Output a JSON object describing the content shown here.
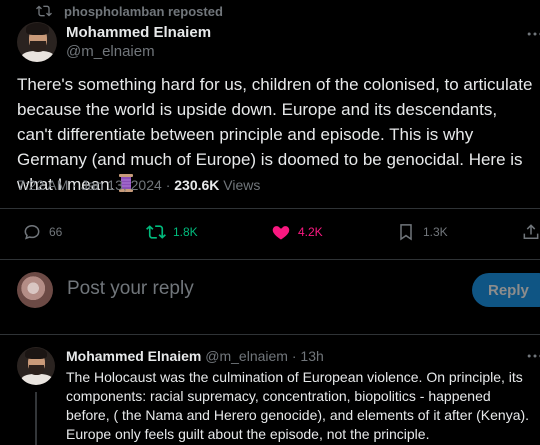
{
  "repost": {
    "label": "phospholamban reposted"
  },
  "main_post": {
    "author_name": "Mohammed Elnaiem",
    "author_handle": "@m_elnaiem",
    "text": "There's something hard for us, children of the colonised, to articulate because the world is upside down. Europe and its descendants, can't differentiate between principle and episode. This is why Germany (and much of Europe) is doomed to be genocidal. Here is what I mean.",
    "emoji_icon": "thread-icon",
    "time": "7:22 AM",
    "date": "Jan 13, 2024",
    "views_count": "230.6K",
    "views_label": "Views"
  },
  "actions": {
    "replies": "66",
    "reposts": "1.8K",
    "likes": "4.2K",
    "bookmarks": "1.3K"
  },
  "reply_composer": {
    "placeholder": "Post your reply",
    "button_label": "Reply"
  },
  "reply_post": {
    "author_name": "Mohammed Elnaiem",
    "author_handle": "@m_elnaiem",
    "time_ago": "13h",
    "text": "The Holocaust was the culmination of European violence. On principle, its components: racial supremacy, concentration, biopolitics - happened before, ( the Nama and Herero genocide), and elements of it after (Kenya). Europe only feels guilt about the episode, not the principle."
  },
  "colors": {
    "background": "#000000",
    "text": "#e7e9ea",
    "muted": "#71767b",
    "repost_green": "#00ba7c",
    "like_pink": "#f91880",
    "accent_blue": "#1d9bf0"
  }
}
